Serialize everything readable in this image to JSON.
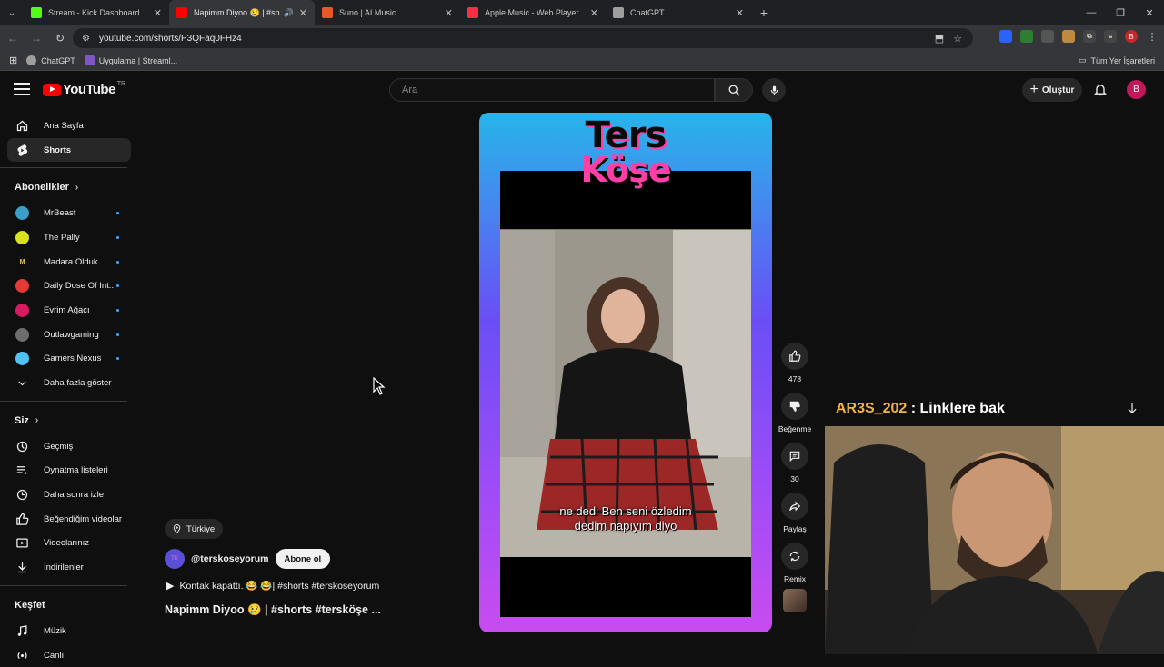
{
  "browser": {
    "tabs": [
      {
        "title": "Stream - Kick Dashboard",
        "color": "#53fc18",
        "active": false
      },
      {
        "title": "Napimm Diyoo 😢 | #shorts",
        "color": "#ff0000",
        "active": true
      },
      {
        "title": "Suno | AI Music",
        "color": "#e8572a",
        "active": false
      },
      {
        "title": "Apple Music - Web Player",
        "color": "#fa2d48",
        "active": false
      },
      {
        "title": "ChatGPT",
        "color": "#9e9e9e",
        "active": false
      }
    ],
    "url": "youtube.com/shorts/P3QFaq0FHz4",
    "bookmarks": [
      {
        "label": "ChatGPT"
      },
      {
        "label": "Uygulama | Streaml..."
      }
    ],
    "all_bookmarks": "Tüm Yer İşaretleri",
    "profile_letter": "B"
  },
  "youtube": {
    "logo_text": "YouTube",
    "region": "TR",
    "search_placeholder": "Ara",
    "create_label": "Oluştur",
    "avatar_letter": "B",
    "sidebar": {
      "main": [
        {
          "label": "Ana Sayfa",
          "icon": "home-icon"
        },
        {
          "label": "Shorts",
          "icon": "shorts-icon",
          "active": true
        }
      ],
      "subs_heading": "Abonelikler",
      "subs": [
        {
          "label": "MrBeast",
          "color": "#3aa0c8",
          "abbr": ""
        },
        {
          "label": "The Pally",
          "color": "#d8e21f",
          "abbr": ""
        },
        {
          "label": "Madara Olduk",
          "color": "#0f0f0f",
          "abbr": "M"
        },
        {
          "label": "Daily Dose Of Int...",
          "color": "#e53935",
          "abbr": ""
        },
        {
          "label": "Evrim Ağacı",
          "color": "#d81b60",
          "abbr": ""
        },
        {
          "label": "Outlawgaming",
          "color": "#6d6d6d",
          "abbr": ""
        },
        {
          "label": "Gamers Nexus",
          "color": "#4fc3f7",
          "abbr": ""
        }
      ],
      "show_more": "Daha fazla göster",
      "you_heading": "Siz",
      "you": [
        {
          "label": "Geçmiş",
          "icon": "history-icon"
        },
        {
          "label": "Oynatma listeleri",
          "icon": "playlists-icon"
        },
        {
          "label": "Daha sonra izle",
          "icon": "watch-later-icon"
        },
        {
          "label": "Beğendiğim videolar",
          "icon": "liked-icon"
        },
        {
          "label": "Videolarınız",
          "icon": "your-videos-icon"
        },
        {
          "label": "İndirilenler",
          "icon": "downloads-icon"
        }
      ],
      "explore_heading": "Keşfet",
      "explore": [
        {
          "label": "Müzik",
          "icon": "music-icon"
        },
        {
          "label": "Canlı",
          "icon": "live-icon"
        }
      ]
    },
    "short": {
      "brand_line1": "Ters",
      "brand_line2": "Köşe",
      "subtitle_line1": "ne dedi Ben seni özledim",
      "subtitle_line2": "dedim napıyım diyo",
      "likes": "478",
      "dislike_label": "Beğenme",
      "comments": "30",
      "share_label": "Paylaş",
      "remix_label": "Remix",
      "location": "Türkiye",
      "channel": "@terskoseyorum",
      "subscribe_label": "Abone ol",
      "audio": "Kontak kapattı. 😂 😂| #shorts #terskoseyorum",
      "title": "Napimm Diyoo 😢 | #shorts #tersköşe ..."
    }
  },
  "overlay": {
    "chat_user": "AR3S_202",
    "chat_message": " : Linklere bak"
  }
}
